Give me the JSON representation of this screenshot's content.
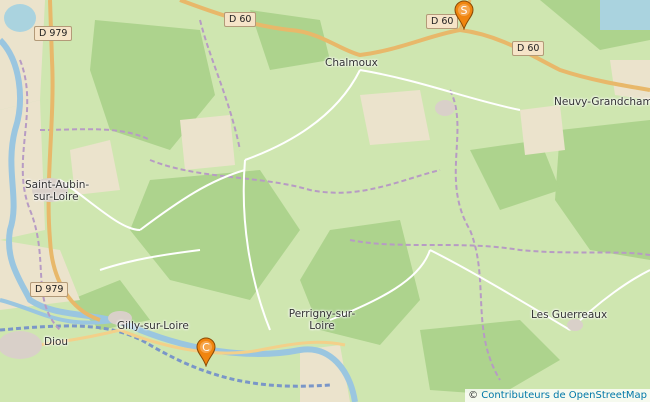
{
  "places": {
    "chalmoux": "Chalmoux",
    "neuvy": "Neuvy-Grandchamp",
    "saint_aubin_1": "Saint-Aubin-",
    "saint_aubin_2": "sur-Loire",
    "gilly": "Gilly-sur-Loire",
    "diou": "Diou",
    "perrigny_1": "Perrigny-sur-",
    "perrigny_2": "Loire",
    "guerreaux": "Les Guerreaux"
  },
  "roads": {
    "d60_top": "D 60",
    "d60_mid": "D 60",
    "d60_right": "D 60",
    "d979_top": "D 979",
    "d979_bottom": "D 979"
  },
  "markers": {
    "start_letter": "S",
    "start_color": "#f0850f",
    "end_letter": "C",
    "end_color": "#f0850f"
  },
  "attribution": {
    "symbol": "©",
    "link": "Contributeurs de OpenStreetMap"
  }
}
